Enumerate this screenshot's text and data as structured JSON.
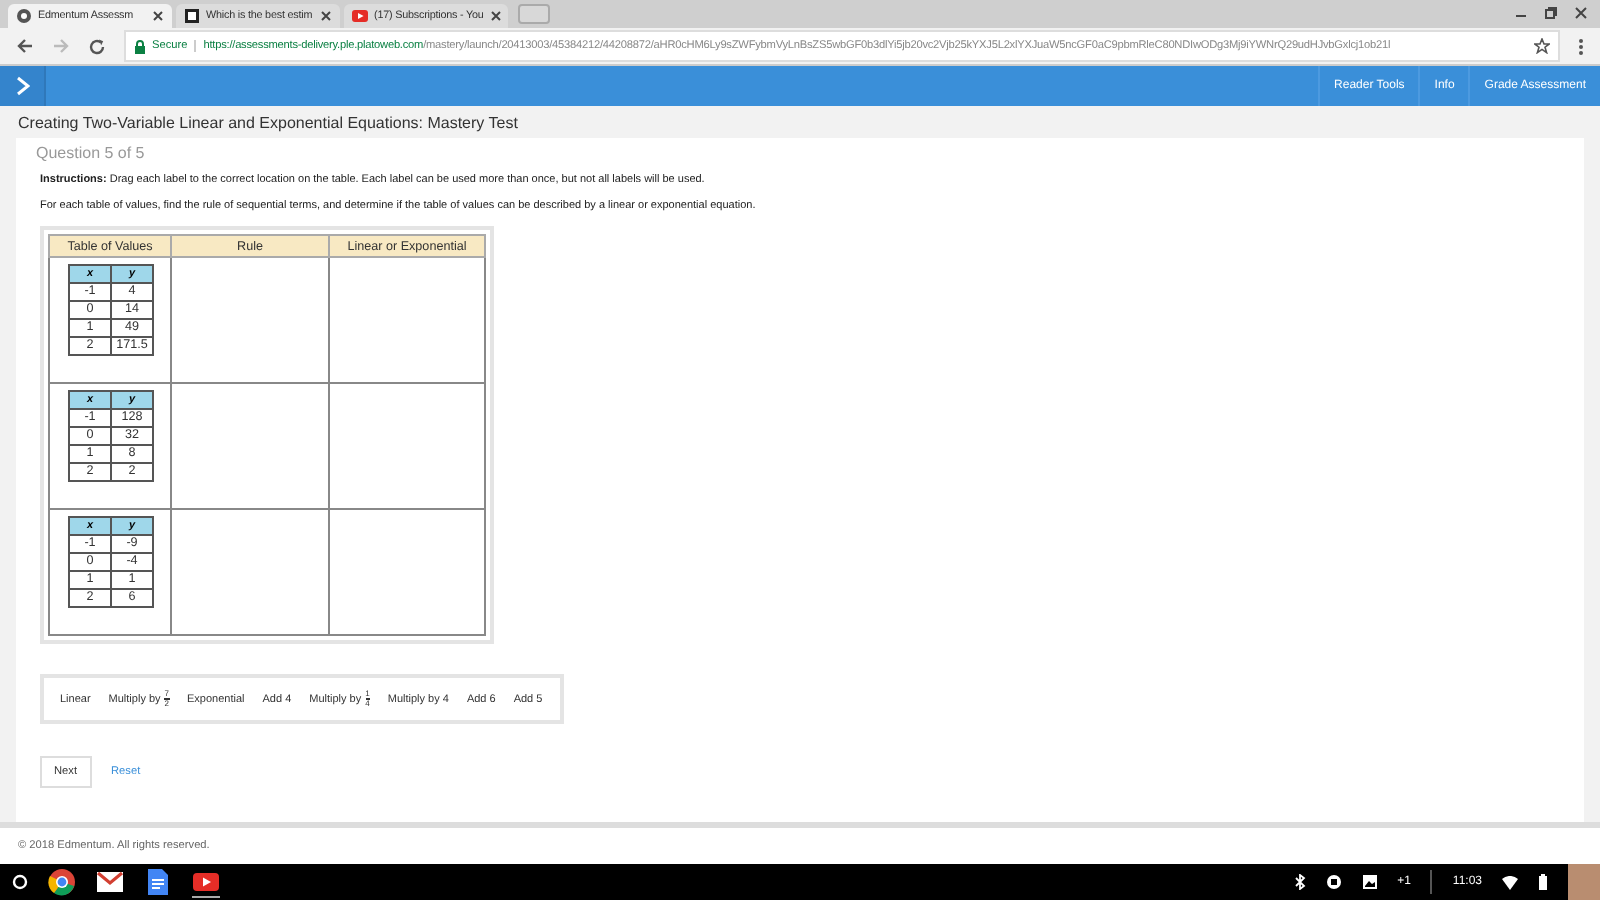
{
  "browser": {
    "tabs": [
      {
        "title": "Edmentum Assessm",
        "selected": true,
        "kind": "edmentum"
      },
      {
        "title": "Which is the best estim",
        "selected": false,
        "kind": "doc"
      },
      {
        "title": "(17) Subscriptions - You",
        "selected": false,
        "kind": "video"
      }
    ],
    "secure_label": "Secure",
    "url_host": "https://assessments-delivery.ple.platoweb.com",
    "url_path": "/mastery/launch/20413003/45384212/44208872/aHR0cHM6Ly9sZWFybmVyLnBsZS5wbGF0b3dlYi5jb20vc2Vjb25kYXJ5L2xlYXJuaW5ncGF0aC9pbmRleC80NDIwODg3Mj9iYWNrQ29udHJvbGxlcj1ob21l"
  },
  "header": {
    "menu": [
      "Reader Tools",
      "Info",
      "Grade Assessment"
    ]
  },
  "test_title": "Creating Two-Variable Linear and Exponential Equations: Mastery Test",
  "question_label": "Question 5 of 5",
  "instructions_label": "Instructions:",
  "instructions": "Drag each label to the correct location on the table. Each label can be used more than once, but not all labels will be used.",
  "prompt": "For each table of values, find the rule of sequential terms, and determine if the table of values can be described by a linear or exponential equation.",
  "table": {
    "columns": [
      "Table of Values",
      "Rule",
      "Linear or Exponential"
    ],
    "rows": [
      {
        "values": {
          "columns": [
            "x",
            "y"
          ],
          "rows": [
            [
              "-1",
              "4"
            ],
            [
              "0",
              "14"
            ],
            [
              "1",
              "49"
            ],
            [
              "2",
              "171.5"
            ]
          ]
        }
      },
      {
        "values": {
          "columns": [
            "x",
            "y"
          ],
          "rows": [
            [
              "-1",
              "128"
            ],
            [
              "0",
              "32"
            ],
            [
              "1",
              "8"
            ],
            [
              "2",
              "2"
            ]
          ]
        }
      },
      {
        "values": {
          "columns": [
            "x",
            "y"
          ],
          "rows": [
            [
              "-1",
              "-9"
            ],
            [
              "0",
              "-4"
            ],
            [
              "1",
              "1"
            ],
            [
              "2",
              "6"
            ]
          ]
        }
      }
    ]
  },
  "labels": [
    {
      "kind": "text",
      "text": "Linear"
    },
    {
      "kind": "fraction",
      "text": "Multiply by",
      "numerator": "7",
      "denominator": "2"
    },
    {
      "kind": "text",
      "text": "Exponential"
    },
    {
      "kind": "text",
      "text": "Add 4"
    },
    {
      "kind": "fraction",
      "text": "Multiply by",
      "numerator": "1",
      "denominator": "4"
    },
    {
      "kind": "text",
      "text": "Multiply by 4"
    },
    {
      "kind": "text",
      "text": "Add 6"
    },
    {
      "kind": "text",
      "text": "Add 5"
    }
  ],
  "buttons": {
    "next": "Next",
    "reset": "Reset"
  },
  "footer": "© 2018 Edmentum. All rights reserved.",
  "taskbar": {
    "tray": [
      "+1",
      "11:03"
    ],
    "apps": [
      {
        "kind": "chrome"
      },
      {
        "kind": "mail"
      },
      {
        "kind": "docs"
      },
      {
        "kind": "video",
        "selected": true
      }
    ]
  }
}
